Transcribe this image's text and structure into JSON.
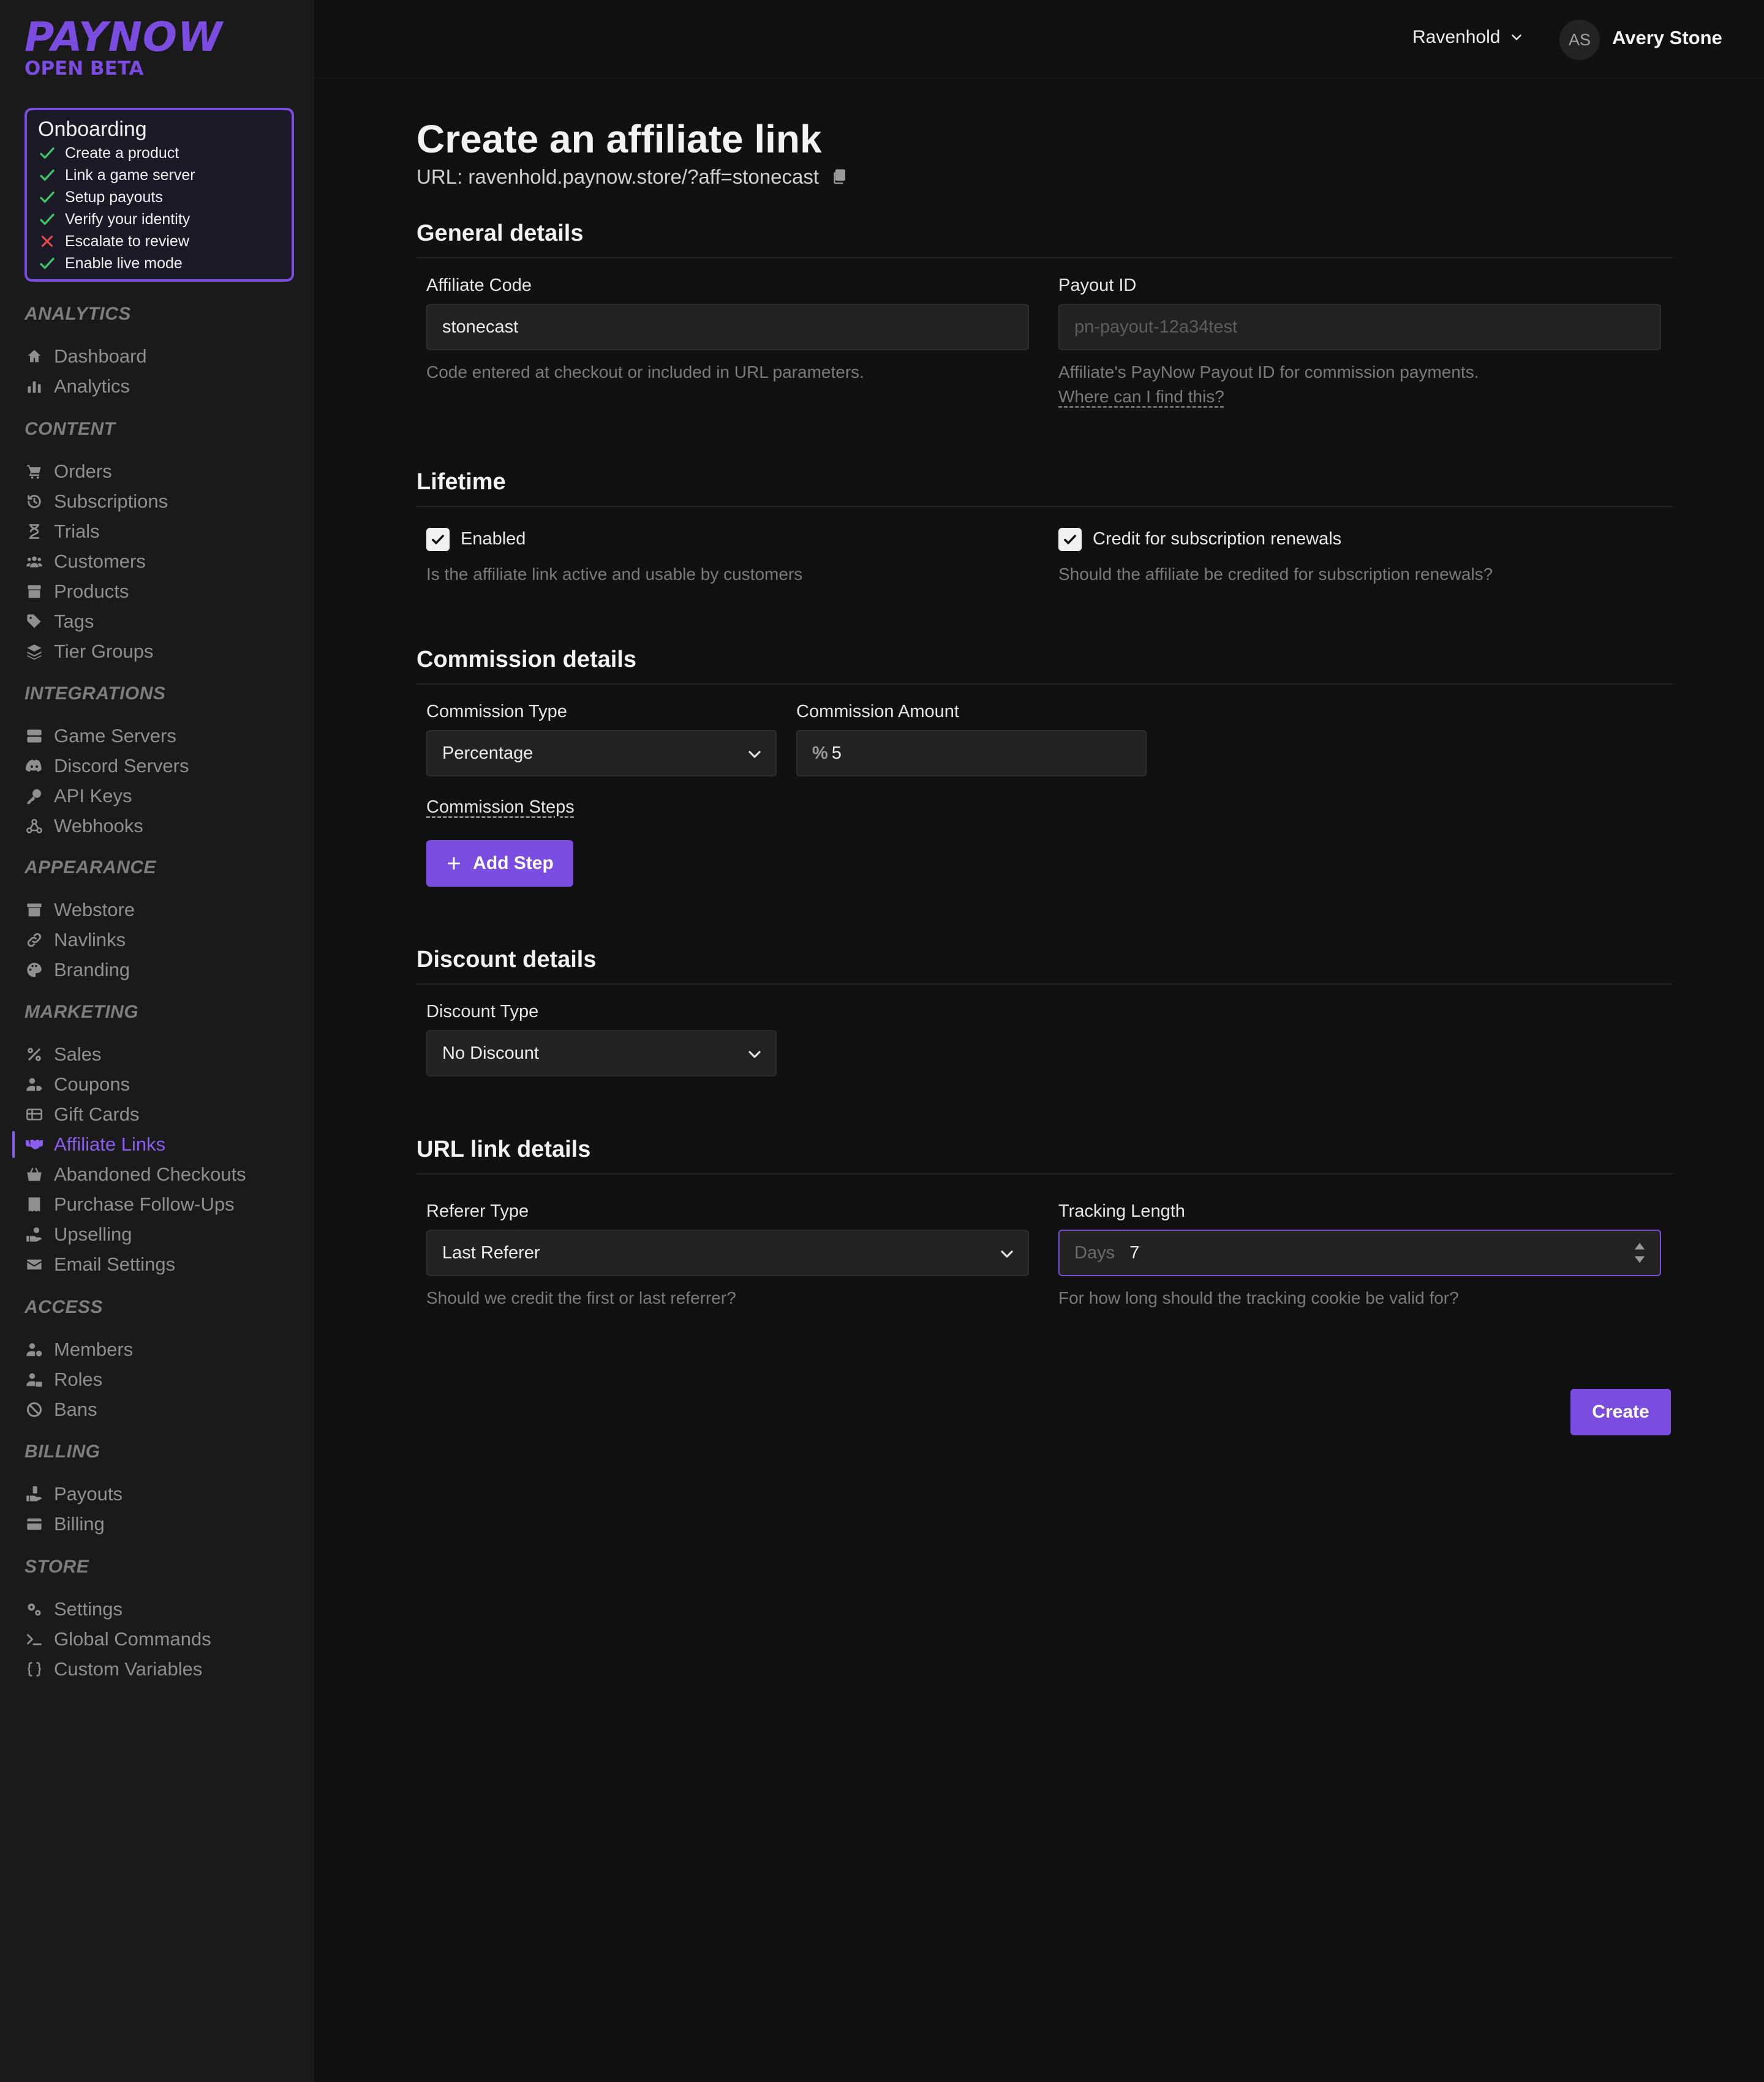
{
  "brand": {
    "name": "PAYNOW",
    "tag": "OPEN BETA",
    "accent": "#7b4ce0"
  },
  "onboarding": {
    "title": "Onboarding",
    "items": [
      {
        "label": "Create a product",
        "status": "done"
      },
      {
        "label": "Link a game server",
        "status": "done"
      },
      {
        "label": "Setup payouts",
        "status": "done"
      },
      {
        "label": "Verify your identity",
        "status": "done"
      },
      {
        "label": "Escalate to review",
        "status": "failed"
      },
      {
        "label": "Enable live mode",
        "status": "done"
      }
    ]
  },
  "sidebar": {
    "sections": [
      {
        "title": "ANALYTICS",
        "items": [
          {
            "label": "Dashboard",
            "icon": "home-icon"
          },
          {
            "label": "Analytics",
            "icon": "bar-chart-icon"
          }
        ]
      },
      {
        "title": "CONTENT",
        "items": [
          {
            "label": "Orders",
            "icon": "cart-icon"
          },
          {
            "label": "Subscriptions",
            "icon": "history-icon"
          },
          {
            "label": "Trials",
            "icon": "hourglass-icon"
          },
          {
            "label": "Customers",
            "icon": "users-icon"
          },
          {
            "label": "Products",
            "icon": "box-icon"
          },
          {
            "label": "Tags",
            "icon": "tag-icon"
          },
          {
            "label": "Tier Groups",
            "icon": "layers-icon"
          }
        ]
      },
      {
        "title": "INTEGRATIONS",
        "items": [
          {
            "label": "Game Servers",
            "icon": "server-icon"
          },
          {
            "label": "Discord Servers",
            "icon": "discord-icon"
          },
          {
            "label": "API Keys",
            "icon": "key-icon"
          },
          {
            "label": "Webhooks",
            "icon": "webhook-icon"
          }
        ]
      },
      {
        "title": "APPEARANCE",
        "items": [
          {
            "label": "Webstore",
            "icon": "store-icon"
          },
          {
            "label": "Navlinks",
            "icon": "link-icon"
          },
          {
            "label": "Branding",
            "icon": "palette-icon"
          }
        ]
      },
      {
        "title": "MARKETING",
        "items": [
          {
            "label": "Sales",
            "icon": "percent-icon"
          },
          {
            "label": "Coupons",
            "icon": "user-tag-icon"
          },
          {
            "label": "Gift Cards",
            "icon": "gift-card-icon"
          },
          {
            "label": "Affiliate Links",
            "icon": "handshake-icon",
            "active": true
          },
          {
            "label": "Abandoned Checkouts",
            "icon": "basket-icon"
          },
          {
            "label": "Purchase Follow-Ups",
            "icon": "receipt-icon"
          },
          {
            "label": "Upselling",
            "icon": "hand-coin-icon"
          },
          {
            "label": "Email Settings",
            "icon": "envelope-icon"
          }
        ]
      },
      {
        "title": "ACCESS",
        "items": [
          {
            "label": "Members",
            "icon": "user-gear-icon"
          },
          {
            "label": "Roles",
            "icon": "user-lock-icon"
          },
          {
            "label": "Bans",
            "icon": "ban-icon"
          }
        ]
      },
      {
        "title": "BILLING",
        "items": [
          {
            "label": "Payouts",
            "icon": "hand-money-icon"
          },
          {
            "label": "Billing",
            "icon": "credit-card-icon"
          }
        ]
      },
      {
        "title": "STORE",
        "items": [
          {
            "label": "Settings",
            "icon": "gears-icon"
          },
          {
            "label": "Global Commands",
            "icon": "terminal-icon"
          },
          {
            "label": "Custom Variables",
            "icon": "braces-icon"
          }
        ]
      }
    ]
  },
  "header": {
    "store": "Ravenhold",
    "user_initials": "AS",
    "user_name": "Avery Stone"
  },
  "page": {
    "title": "Create an affiliate link",
    "url": "URL: ravenhold.paynow.store/?aff=stonecast",
    "general": {
      "title": "General details",
      "affiliate_code_label": "Affiliate Code",
      "affiliate_code_value": "stonecast",
      "affiliate_code_hint": "Code entered at checkout or included in URL parameters.",
      "payout_id_label": "Payout ID",
      "payout_id_placeholder": "pn-payout-12a34test",
      "payout_id_hint": "Affiliate's PayNow Payout ID for commission payments.",
      "payout_id_link": "Where can I find this?"
    },
    "lifetime": {
      "title": "Lifetime",
      "enabled_label": "Enabled",
      "enabled_checked": true,
      "enabled_hint": "Is the affiliate link active and usable by customers",
      "renewals_label": "Credit for subscription renewals",
      "renewals_checked": true,
      "renewals_hint": "Should the affiliate be credited for subscription renewals?"
    },
    "commission": {
      "title": "Commission details",
      "type_label": "Commission Type",
      "type_value": "Percentage",
      "amount_label": "Commission Amount",
      "amount_prefix": "%",
      "amount_value": "5",
      "steps_label": "Commission Steps",
      "add_step_label": "Add Step"
    },
    "discount": {
      "title": "Discount details",
      "type_label": "Discount Type",
      "type_value": "No Discount"
    },
    "url_details": {
      "title": "URL link details",
      "referer_label": "Referer Type",
      "referer_value": "Last Referer",
      "referer_hint": "Should we credit the first or last referrer?",
      "tracking_label": "Tracking Length",
      "tracking_prefix": "Days",
      "tracking_value": "7",
      "tracking_hint": "For how long should the tracking cookie be valid for?"
    },
    "create_label": "Create"
  }
}
